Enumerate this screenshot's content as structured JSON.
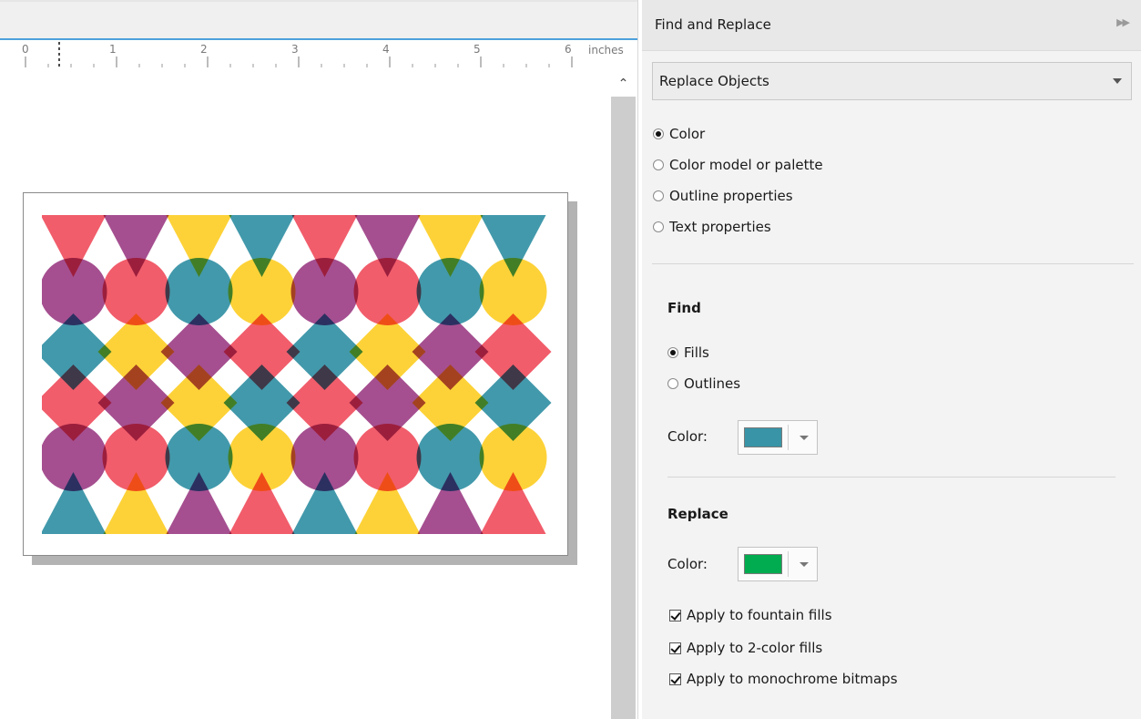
{
  "ruler": {
    "numbers": [
      "0",
      "1",
      "2",
      "3",
      "4",
      "5",
      "6"
    ],
    "unit": "inches"
  },
  "panel": {
    "title": "Find and Replace",
    "mode_select": "Replace Objects",
    "replace_by": [
      {
        "label": "Color",
        "selected": true
      },
      {
        "label": "Color model or palette",
        "selected": false
      },
      {
        "label": "Outline properties",
        "selected": false
      },
      {
        "label": "Text properties",
        "selected": false
      }
    ],
    "find": {
      "title": "Find",
      "targets": [
        {
          "label": "Fills",
          "selected": true
        },
        {
          "label": "Outlines",
          "selected": false
        }
      ],
      "color_label": "Color:",
      "color": "#3894a6"
    },
    "replace": {
      "title": "Replace",
      "color_label": "Color:",
      "color": "#00ac4f"
    },
    "options": [
      {
        "label": "Apply to fountain fills",
        "checked": true
      },
      {
        "label": "Apply to 2-color fills",
        "checked": true
      },
      {
        "label": "Apply to monochrome bitmaps",
        "checked": true
      }
    ]
  },
  "palette": {
    "red": "#f05463",
    "purple": "#a0468a",
    "yellow": "#fdd02d",
    "teal": "#3894a6"
  }
}
